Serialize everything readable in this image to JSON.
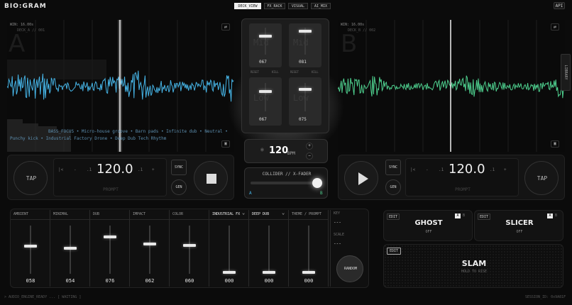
{
  "app": {
    "logo": "BIO:GRAM",
    "api_label": "API"
  },
  "tabs": [
    {
      "label": "DECK_VIEW",
      "active": true
    },
    {
      "label": "FX_RACK",
      "active": false
    },
    {
      "label": "VISUAL",
      "active": false
    },
    {
      "label": "AI_MIX",
      "active": false
    }
  ],
  "deck_a": {
    "win": "WIN: 16.00s",
    "id": "DECK_A // 001",
    "big_letter": "A",
    "tags_line1": "BASS_FOCUS • Micro-house groove • Barn pads • Infinite dub • Neutral •",
    "tags_line2": "Punchy kick • Industrial Factory Drone • Deep Dub Tech Rhythm",
    "bpm": "120.0",
    "prompt": "PROMPT",
    "sync": "SYNC",
    "gen": "GEN",
    "tap": "TAP",
    "nudge": [
      "|<",
      "-",
      ".1",
      ".1",
      "+",
      ">|"
    ]
  },
  "deck_b": {
    "win": "WIN: 16.00s",
    "id": "DECK_B // 002",
    "big_letter": "B",
    "bpm": "120.0",
    "prompt": "PROMPT",
    "sync": "SYNC",
    "gen": "GEN",
    "tap": "TAP",
    "nudge": [
      "|<",
      "-",
      ".1",
      ".1",
      "+",
      ">|"
    ]
  },
  "library_label": "LIBRARY",
  "mixer": {
    "ch1_top_val": "067",
    "ch2_top_val": "081",
    "ch1_low_val": "067",
    "ch2_low_val": "075",
    "reset": "RESET",
    "kill": "KILL",
    "mid": "Mid",
    "low": "Low",
    "bpm_value": "120",
    "bpm_unit": "BPM",
    "crossfader_title": "COLLIDER // X-FADER",
    "cf_a": "A",
    "cf_b": "B"
  },
  "macros": [
    {
      "label": "AMBIENT",
      "value": "058",
      "level": 0.58
    },
    {
      "label": "MINIMAL",
      "value": "054",
      "level": 0.54
    },
    {
      "label": "DUB",
      "value": "076",
      "level": 0.76
    },
    {
      "label": "IMPACT",
      "value": "062",
      "level": 0.62
    },
    {
      "label": "COLOR",
      "value": "060",
      "level": 0.6
    }
  ],
  "style_cols": [
    {
      "label": "INDUSTRIAL FX",
      "value": "000",
      "dropdown": true
    },
    {
      "label": "DEEP DUB",
      "value": "000",
      "dropdown": true
    },
    {
      "label": "THEME / PROMPT",
      "value": "000",
      "dropdown": false
    }
  ],
  "key_label": "KEY",
  "key_value": "---",
  "scale_label": "SCALE",
  "scale_value": "---",
  "random_label": "RANDOM",
  "fx": {
    "ghost": {
      "edit": "EDIT",
      "title": "GHOST",
      "state": "OFF",
      "a": "A",
      "b": "B"
    },
    "slicer": {
      "edit": "EDIT",
      "title": "SLICER",
      "state": "OFF",
      "a": "A",
      "b": "B"
    },
    "slam": {
      "edit": "EDIT",
      "title": "SLAM",
      "hint": "HOLD TO RISE"
    }
  },
  "status": {
    "left": "> AUDIO_ENGINE_READY ... [ WAITING ]",
    "right": "SESSION_ID: 0x9A81F"
  },
  "colors": {
    "deck_a": "#46b4e6",
    "deck_b": "#4ecf8e"
  }
}
